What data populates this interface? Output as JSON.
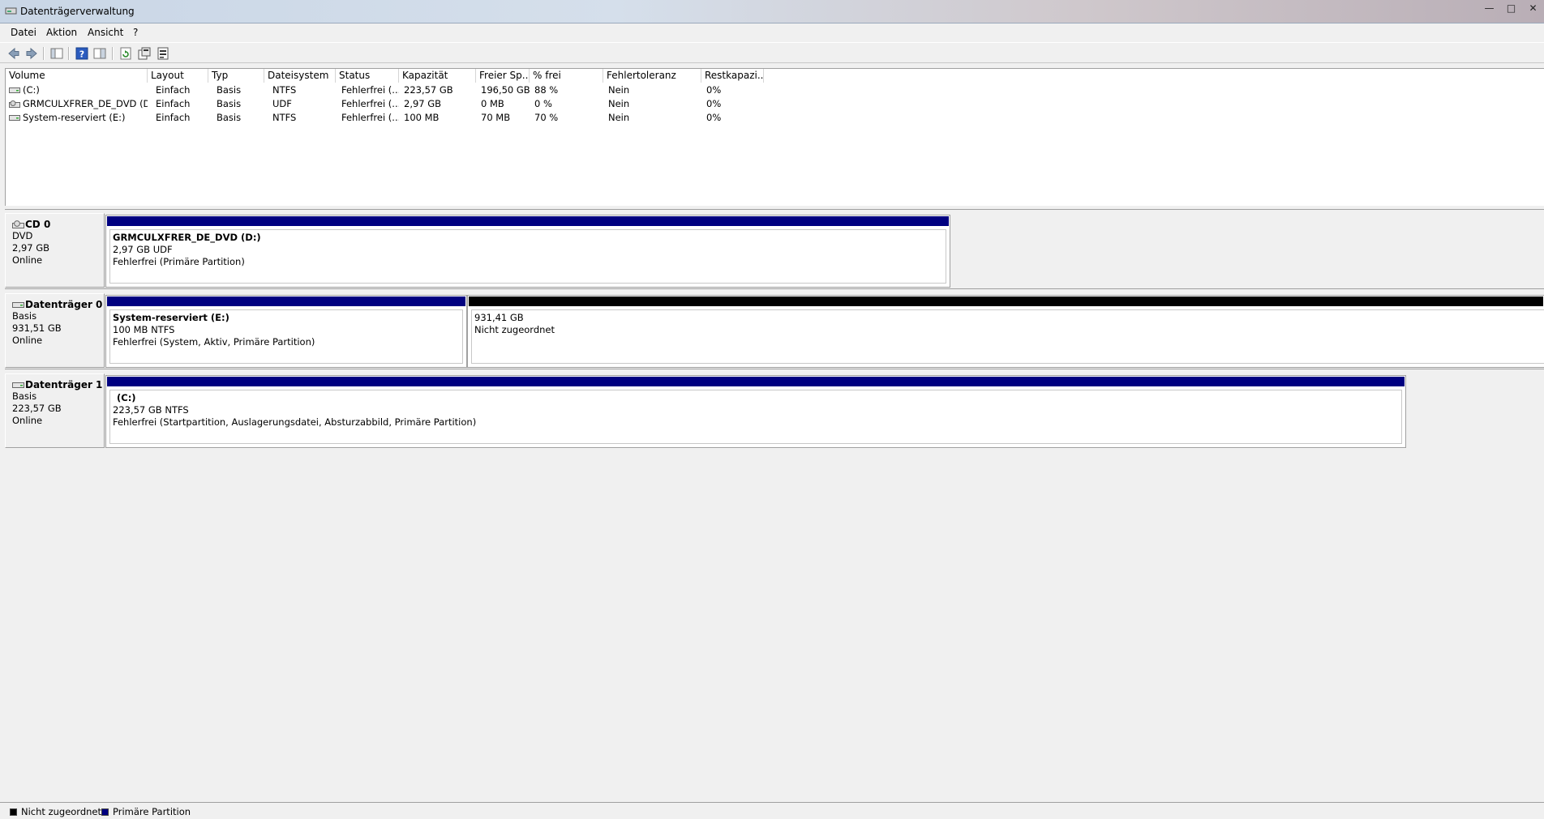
{
  "window": {
    "title": "Datenträgerverwaltung",
    "minimize": "—",
    "maximize": "□",
    "close": "✕"
  },
  "menu": {
    "items": [
      "Datei",
      "Aktion",
      "Ansicht",
      "?"
    ]
  },
  "toolbar": {
    "icons": [
      "back-icon",
      "forward-icon",
      "console-tree-icon",
      "help-icon",
      "properties-pane-icon",
      "refresh-icon",
      "export-icon",
      "settings-icon"
    ]
  },
  "volumes": {
    "columns": [
      "Volume",
      "Layout",
      "Typ",
      "Dateisystem",
      "Status",
      "Kapazität",
      "Freier Sp...",
      "% frei",
      "Fehlertoleranz",
      "Restkapazi..."
    ],
    "rows": [
      [
        "(C:)",
        "Einfach",
        "Basis",
        "NTFS",
        "Fehlerfrei (...",
        "223,57 GB",
        "196,50 GB",
        "88 %",
        "Nein",
        "0%"
      ],
      [
        "GRMCULXFRER_DE_DVD (D:)",
        "Einfach",
        "Basis",
        "UDF",
        "Fehlerfrei (...",
        "2,97 GB",
        "0 MB",
        "0 %",
        "Nein",
        "0%"
      ],
      [
        "System-reserviert (E:)",
        "Einfach",
        "Basis",
        "NTFS",
        "Fehlerfrei (...",
        "100 MB",
        "70 MB",
        "70 %",
        "Nein",
        "0%"
      ]
    ]
  },
  "disks": [
    {
      "name": "CD 0",
      "type": "DVD",
      "size": "2,97 GB",
      "status": "Online",
      "partitions": [
        {
          "name": "GRMCULXFRER_DE_DVD  (D:)",
          "line1": "2,97 GB UDF",
          "line2": "Fehlerfrei (Primäre Partition)"
        }
      ]
    },
    {
      "name": "Datenträger 0",
      "type": "Basis",
      "size": "931,51 GB",
      "status": "Online",
      "partitions": [
        {
          "name": "System-reserviert  (E:)",
          "line1": "100 MB NTFS",
          "line2": "Fehlerfrei (System, Aktiv, Primäre Partition)"
        },
        {
          "name": "",
          "line1": "931,41 GB",
          "line2": "Nicht zugeordnet"
        }
      ]
    },
    {
      "name": "Datenträger 1",
      "type": "Basis",
      "size": "223,57 GB",
      "status": "Online",
      "partitions": [
        {
          "name": "(C:)",
          "line1": "223,57 GB NTFS",
          "line2": "Fehlerfrei (Startpartition, Auslagerungsdatei, Absturzabbild, Primäre Partition)"
        }
      ]
    }
  ],
  "legend": [
    {
      "label": "Nicht zugeordnet",
      "color": "#000000"
    },
    {
      "label": "Primäre Partition",
      "color": "#000080"
    }
  ],
  "colors": {
    "primary_partition": "#000080",
    "unallocated": "#000000"
  }
}
